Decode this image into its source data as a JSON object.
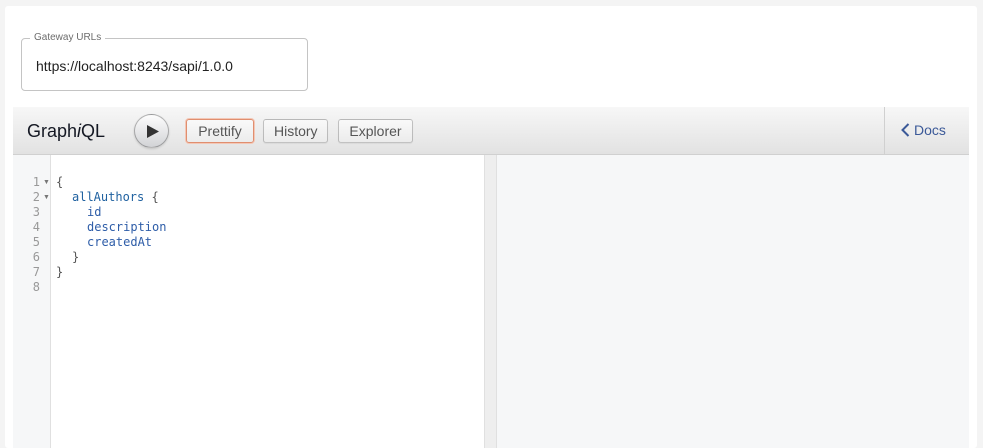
{
  "gateway": {
    "legend": "Gateway URLs",
    "url": "https://localhost:8243/sapi/1.0.0"
  },
  "graphiql": {
    "title_prefix": "Graph",
    "title_italic": "i",
    "title_suffix": "QL",
    "buttons": {
      "prettify": "Prettify",
      "history": "History",
      "explorer": "Explorer"
    },
    "docs": "Docs"
  },
  "editor": {
    "line_numbers": [
      "1",
      "2",
      "3",
      "4",
      "5",
      "6",
      "7",
      "8"
    ],
    "fold_marker": "▼",
    "lines": {
      "l1": "{",
      "l2_field": "allAuthors",
      "l2_brace": " {",
      "l3": "id",
      "l4": "description",
      "l5": "createdAt",
      "l6": "}",
      "l7": "}"
    }
  },
  "colors": {
    "accent_prettify": "#e08e6f",
    "docs_link": "#3b5998",
    "field": "#1f61a0"
  },
  "icons": {
    "run": "play-icon",
    "docs": "chevron-left-icon"
  }
}
